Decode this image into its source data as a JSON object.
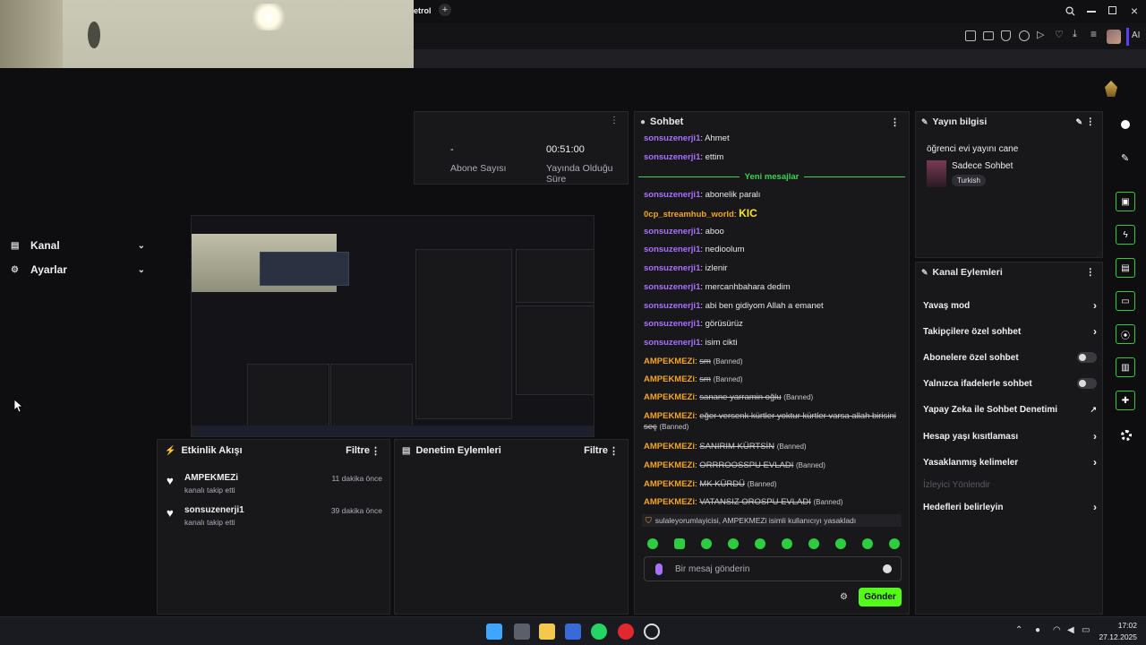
{
  "browser": {
    "tab_text": "etrol",
    "tab_add": "+",
    "ai_label": "AI"
  },
  "sidebar": {
    "items": [
      {
        "label": "Kanal"
      },
      {
        "label": "Ayarlar"
      }
    ]
  },
  "stats": {
    "sub_value": "-",
    "sub_label": "Abone Sayısı",
    "live_value": "00:51:00",
    "live_label": "Yayında Olduğu Süre"
  },
  "activity": {
    "title": "Etkinlik Akışı",
    "filter_label": "Filtre",
    "items": [
      {
        "user": "AMPEKMEZi",
        "action": "kanalı takip etti",
        "time": "11 dakika önce"
      },
      {
        "user": "sonsuzenerji1",
        "action": "kanalı takip etti",
        "time": "39 dakika önce"
      }
    ]
  },
  "moderation": {
    "title": "Denetim Eylemleri",
    "filter_label": "Filtre"
  },
  "chat": {
    "title": "Sohbet",
    "new_messages_label": "Yeni mesajlar",
    "messages_before": [
      {
        "user": "sonsuzenerji1",
        "text": "Ahmet"
      },
      {
        "user": "sonsuzenerji1",
        "text": "ettim"
      }
    ],
    "messages_after": [
      {
        "user": "sonsuzenerji1",
        "text": "abonelik paralı",
        "style": "purple"
      },
      {
        "user": "0cp_streamhub_world",
        "text": "KIC",
        "style": "orange"
      },
      {
        "user": "sonsuzenerji1",
        "text": "aboo",
        "style": "purple"
      },
      {
        "user": "sonsuzenerji1",
        "text": "nedioolum",
        "style": "purple"
      },
      {
        "user": "sonsuzenerji1",
        "text": "izlenir",
        "style": "purple"
      },
      {
        "user": "sonsuzenerji1",
        "text": "mercanhbahara dedim",
        "style": "purple"
      },
      {
        "user": "sonsuzenerji1",
        "text": "abi ben gidiyom Allah a emanet",
        "style": "purple"
      },
      {
        "user": "sonsuzenerji1",
        "text": "görüsürüz",
        "style": "purple"
      },
      {
        "user": "sonsuzenerji1",
        "text": "isim cikti",
        "style": "purple"
      }
    ],
    "banned_messages": [
      {
        "user": "AMPEKMEZi",
        "text": "sm",
        "tag": "(Banned)"
      },
      {
        "user": "AMPEKMEZi",
        "text": "sm",
        "tag": "(Banned)"
      },
      {
        "user": "AMPEKMEZi",
        "text": "sanane yarramin oğlu",
        "tag": "(Banned)"
      },
      {
        "user": "AMPEKMEZi",
        "text": "eğer versenk kürtler yoktur kürtler varsa allah birisini seç",
        "tag": "(Banned)"
      },
      {
        "user": "AMPEKMEZi",
        "text": "SANIRIM KÜRTSİN",
        "tag": "(Banned)"
      },
      {
        "user": "AMPEKMEZi",
        "text": "ORRROOSSPU EVLADI",
        "tag": "(Banned)"
      },
      {
        "user": "AMPEKMEZi",
        "text": "MK KÜRDÜ",
        "tag": "(Banned)"
      },
      {
        "user": "AMPEKMEZi",
        "text": "VATANSIZ OROSPU EVLADI",
        "tag": "(Banned)"
      }
    ],
    "ban_notice": "sulaleyorumlayicisi, AMPEKMEZi isimli kullanıcıyı yasakladı",
    "input_placeholder": "Bir mesaj gönderin",
    "send_label": "Gönder"
  },
  "stream_info": {
    "title": "Yayın bilgisi",
    "stream_title": "öğrenci evi yayını cane",
    "category": "Sadece Sohbet",
    "language": "Turkish"
  },
  "channel_actions": {
    "title": "Kanal Eylemleri",
    "items": [
      {
        "label": "Yavaş mod",
        "control": "chevron"
      },
      {
        "label": "Takipçilere özel sohbet",
        "control": "chevron"
      },
      {
        "label": "Abonelere özel sohbet",
        "control": "toggle"
      },
      {
        "label": "Yalnızca ifadelerle sohbet",
        "control": "toggle"
      },
      {
        "label": "Yapay Zeka ile Sohbet Denetimi",
        "control": "external"
      },
      {
        "label": "Hesap yaşı kısıtlaması",
        "control": "chevron"
      },
      {
        "label": "Yasaklanmış kelimeler",
        "control": "chevron"
      },
      {
        "label": "İzleyici Yönlendir",
        "control": "disabled"
      },
      {
        "label": "Hedefleri belirleyin",
        "control": "chevron"
      }
    ]
  },
  "taskbar": {
    "time": "17:02",
    "date": "27.12.2025"
  },
  "colors": {
    "accent": "#53fc18",
    "purple_user": "#a970ff",
    "orange_user": "#f5a524",
    "panel_bg": "#18181b"
  }
}
